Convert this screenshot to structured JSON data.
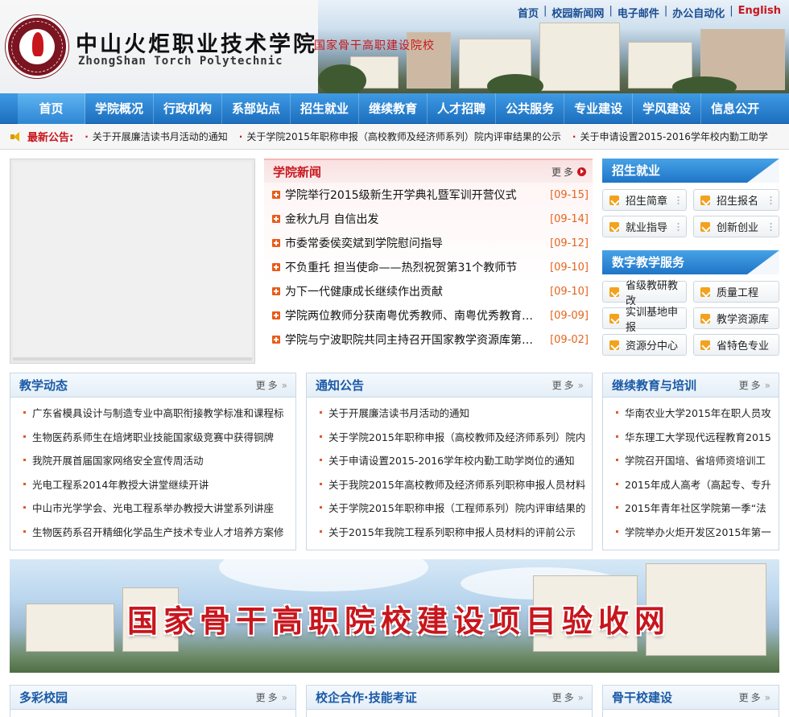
{
  "header": {
    "school_cn": "中山火炬职业技术学院",
    "school_en": "ZhongShan Torch Polytechnic",
    "slogan": "国家骨干高职建设院校",
    "top_links": [
      "首页",
      "校园新闻网",
      "电子邮件",
      "办公自动化",
      "English"
    ]
  },
  "nav": {
    "items": [
      "首页",
      "学院概况",
      "行政机构",
      "系部站点",
      "招生就业",
      "继续教育",
      "人才招聘",
      "公共服务",
      "专业建设",
      "学风建设",
      "信息公开"
    ]
  },
  "notice": {
    "label": "最新公告:",
    "items": [
      "关于开展廉洁读书月活动的通知",
      "关于学院2015年职称申报（高校教师及经济师系列）院内评审结果的公示",
      "关于申请设置2015-2016学年校内勤工助学"
    ]
  },
  "news": {
    "title": "学院新闻",
    "more": "更多",
    "items": [
      {
        "text": "学院举行2015级新生开学典礼暨军训开营仪式",
        "date": "[09-15]"
      },
      {
        "text": "金秋九月 自信出发",
        "date": "[09-14]"
      },
      {
        "text": "市委常委侯奕斌到学院慰问指导",
        "date": "[09-12]"
      },
      {
        "text": "不负重托 担当使命——热烈祝贺第31个教师节",
        "date": "[09-10]"
      },
      {
        "text": "为下一代健康成长继续作出贡献",
        "date": "[09-10]"
      },
      {
        "text": "学院两位教师分获南粤优秀教师、南粤优秀教育工作者称号",
        "date": "[09-09]"
      },
      {
        "text": "学院与宁波职院共同主持召开国家教学资源库第一次工作会议",
        "date": "[09-02]"
      }
    ]
  },
  "services": [
    {
      "title": "招生就业",
      "buttons": [
        "招生简章",
        "招生报名",
        "就业指导",
        "创新创业"
      ]
    },
    {
      "title": "数字教学服务",
      "buttons": [
        "省级教研教改",
        "质量工程",
        "实训基地申报",
        "教学资源库",
        "资源分中心",
        "省特色专业"
      ]
    }
  ],
  "panels": [
    {
      "title": "教学动态",
      "more": "更多",
      "items": [
        "广东省模具设计与制造专业中高职衔接教学标准和课程标",
        "生物医药系师生在焙烤职业技能国家级竞赛中获得铜牌",
        "我院开展首届国家网络安全宣传周活动",
        "光电工程系2014年教授大讲堂继续开讲",
        "中山市光学学会、光电工程系举办教授大讲堂系列讲座",
        "生物医药系召开精细化学品生产技术专业人才培养方案修"
      ]
    },
    {
      "title": "通知公告",
      "more": "更多",
      "items": [
        "关于开展廉洁读书月活动的通知",
        "关于学院2015年职称申报（高校教师及经济师系列）院内",
        "关于申请设置2015-2016学年校内勤工助学岗位的通知",
        "关于我院2015年高校教师及经济师系列职称申报人员材料",
        "关于学院2015年职称申报（工程师系列）院内评审结果的",
        "关于2015年我院工程系列职称申报人员材料的评前公示"
      ]
    },
    {
      "title": "继续教育与培训",
      "more": "更多",
      "items": [
        "华南农业大学2015年在职人员攻",
        "华东理工大学现代远程教育2015",
        "学院召开国培、省培师资培训工",
        "2015年成人高考（高起专、专升",
        "2015年青年社区学院第一季“法",
        "学院举办火炬开发区2015年第一"
      ]
    }
  ],
  "banner": {
    "title": "国家骨干高职院校建设项目验收网"
  },
  "bottom_panels": [
    {
      "title": "多彩校园",
      "more": "更多"
    },
    {
      "title": "校企合作·技能考证",
      "more": "更多"
    },
    {
      "title": "骨干校建设",
      "more": "更多"
    }
  ]
}
